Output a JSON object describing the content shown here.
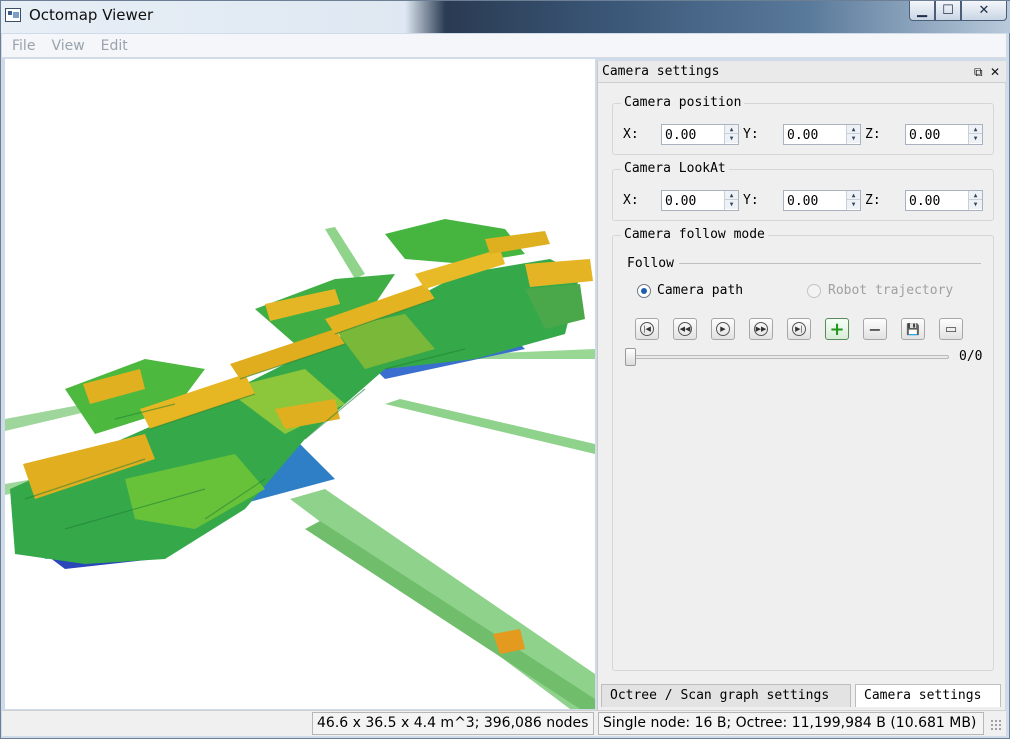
{
  "window": {
    "title": "Octomap Viewer",
    "icons": {
      "app": "octomap-app-icon",
      "minimize": "minimize-icon",
      "maximize": "maximize-icon",
      "close": "close-icon"
    },
    "controls": {
      "minimize": "▁",
      "maximize": "☐",
      "close": "✕"
    }
  },
  "menu": {
    "items": [
      "File",
      "View",
      "Edit"
    ]
  },
  "dock": {
    "title": "Camera settings",
    "float_glyph": "⧉",
    "close_glyph": "✕",
    "camera_position": {
      "label": "Camera position",
      "x_label": "X:",
      "y_label": "Y:",
      "z_label": "Z:",
      "x": "0.00",
      "y": "0.00",
      "z": "0.00"
    },
    "camera_lookat": {
      "label": "Camera LookAt",
      "x_label": "X:",
      "y_label": "Y:",
      "z_label": "Z:",
      "x": "0.00",
      "y": "0.00",
      "z": "0.00"
    },
    "follow_mode": {
      "label": "Camera follow mode",
      "follow_label": "Follow",
      "options": [
        {
          "label": "Camera path",
          "checked": true,
          "enabled": true
        },
        {
          "label": "Robot trajectory",
          "checked": false,
          "enabled": false
        }
      ]
    },
    "toolbar": {
      "buttons": [
        {
          "name": "first-frame-icon",
          "glyph": "|◀"
        },
        {
          "name": "previous-frame-icon",
          "glyph": "◀◀"
        },
        {
          "name": "play-icon",
          "glyph": "▶"
        },
        {
          "name": "next-frame-icon",
          "glyph": "▶▶"
        },
        {
          "name": "last-frame-icon",
          "glyph": "▶|"
        },
        {
          "name": "add-frame-icon",
          "glyph": "+"
        },
        {
          "name": "remove-frame-icon",
          "glyph": "−"
        },
        {
          "name": "save-path-icon",
          "glyph": "💾"
        },
        {
          "name": "record-path-icon",
          "glyph": "▭"
        }
      ]
    },
    "slider": {
      "value": 0,
      "max": 0,
      "readout": "0/0"
    },
    "tabs": [
      {
        "label": "Octree / Scan graph settings",
        "active": false
      },
      {
        "label": "Camera settings",
        "active": true
      }
    ]
  },
  "status": {
    "dimensions": "46.6 x 36.5 x 4.4 m^3; 396,086 nodes",
    "memory": "Single node: 16 B; Octree: 11,199,984 B (10.681 MB)"
  },
  "colors": {
    "accent": "#1d5fae",
    "map_yellow": "#e3b21c",
    "map_green": "#35a84a",
    "map_blue": "#2b46b8",
    "ray_green": "#8fd08a"
  }
}
